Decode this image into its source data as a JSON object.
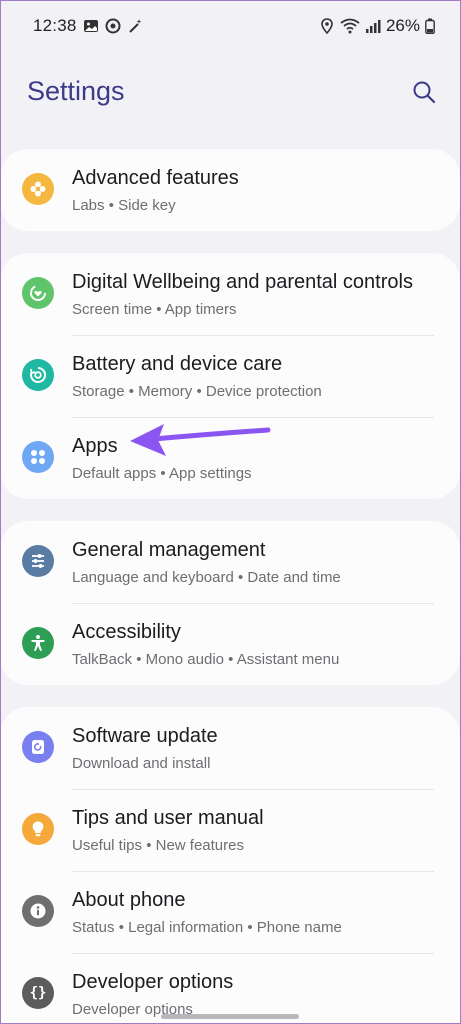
{
  "status_bar": {
    "time": "12:38",
    "battery": "26%"
  },
  "header": {
    "title": "Settings",
    "search_icon": "search-icon"
  },
  "colors": {
    "title": "#3d3a8a",
    "background": "#f2f1f6",
    "card": "#fcfcfd",
    "advanced": "#f5b740",
    "wellbeing": "#5fc46a",
    "battery": "#1fb8a3",
    "apps": "#6ea8f5",
    "general": "#5a7ca3",
    "accessibility": "#2e9e55",
    "software": "#7a7ff0",
    "tips": "#f5a93a",
    "about": "#6f6f6f",
    "developer": "#5c5c5c",
    "arrow": "#8b55f2"
  },
  "groups": [
    {
      "items": [
        {
          "title": "Advanced features",
          "subtitle": "Labs  •  Side key",
          "icon": "gear-puzzle-icon"
        }
      ]
    },
    {
      "items": [
        {
          "title": "Digital Wellbeing and parental controls",
          "subtitle": "Screen time  •  App timers",
          "icon": "wellbeing-icon"
        },
        {
          "title": "Battery and device care",
          "subtitle": "Storage  •  Memory  •  Device protection",
          "icon": "device-care-icon"
        },
        {
          "title": "Apps",
          "subtitle": "Default apps  •  App settings",
          "icon": "apps-grid-icon"
        }
      ]
    },
    {
      "items": [
        {
          "title": "General management",
          "subtitle": "Language and keyboard  •  Date and time",
          "icon": "sliders-icon"
        },
        {
          "title": "Accessibility",
          "subtitle": "TalkBack  •  Mono audio  •  Assistant menu",
          "icon": "accessibility-icon"
        }
      ]
    },
    {
      "items": [
        {
          "title": "Software update",
          "subtitle": "Download and install",
          "icon": "update-icon"
        },
        {
          "title": "Tips and user manual",
          "subtitle": "Useful tips  •  New features",
          "icon": "lightbulb-icon"
        },
        {
          "title": "About phone",
          "subtitle": "Status  •  Legal information  •  Phone name",
          "icon": "info-icon"
        },
        {
          "title": "Developer options",
          "subtitle": "Developer options",
          "icon": "code-braces-icon"
        }
      ]
    }
  ]
}
